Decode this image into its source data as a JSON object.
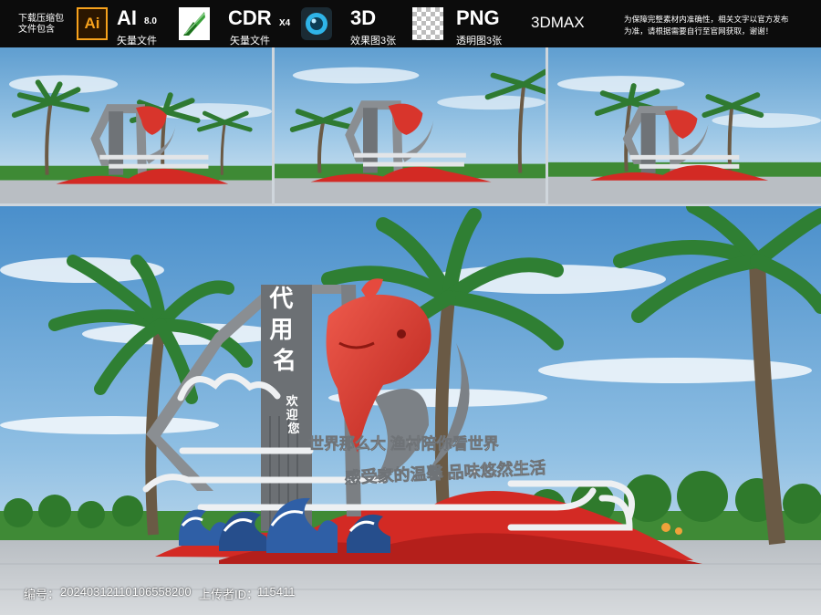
{
  "topbar": {
    "left_note": [
      "下载压缩包",
      "文件包含"
    ],
    "ai": {
      "icon": "ai-file-icon",
      "badge": "Ai",
      "label": "AI",
      "version": "8.0",
      "sub": "矢量文件"
    },
    "cdr": {
      "icon": "coreldraw-icon",
      "label": "CDR",
      "version": "X4",
      "sub": "矢量文件"
    },
    "render3d": {
      "icon": "3d-render-icon",
      "label": "3D",
      "sub": "效果图3张"
    },
    "png": {
      "icon": "transparent-checker-icon",
      "label": "PNG",
      "sub": "透明图3张"
    },
    "max": {
      "label": "3DMAX"
    },
    "right_note": [
      "为保障完整素材内准确性，相关文字以官方发布",
      "为准，请根据需要自行至官网获取，谢谢！"
    ]
  },
  "scene": {
    "sign_name": "代用名",
    "welcome": "欢迎您",
    "slogan_1": "世界那么大 渔村陪你看世界",
    "slogan_2": "感受家的温馨 品味悠然生活"
  },
  "footer": {
    "id_label": "编号：",
    "id_value": "20240312110106558200",
    "uploader_label": "上传者ID：",
    "uploader_value": "115411"
  },
  "colors": {
    "sky_top": "#5f9ed0",
    "fish_red": "#d8352c",
    "frame_gray": "#8a8e92",
    "ground_red": "#d32a24",
    "plaza": "#c9cdd1"
  }
}
